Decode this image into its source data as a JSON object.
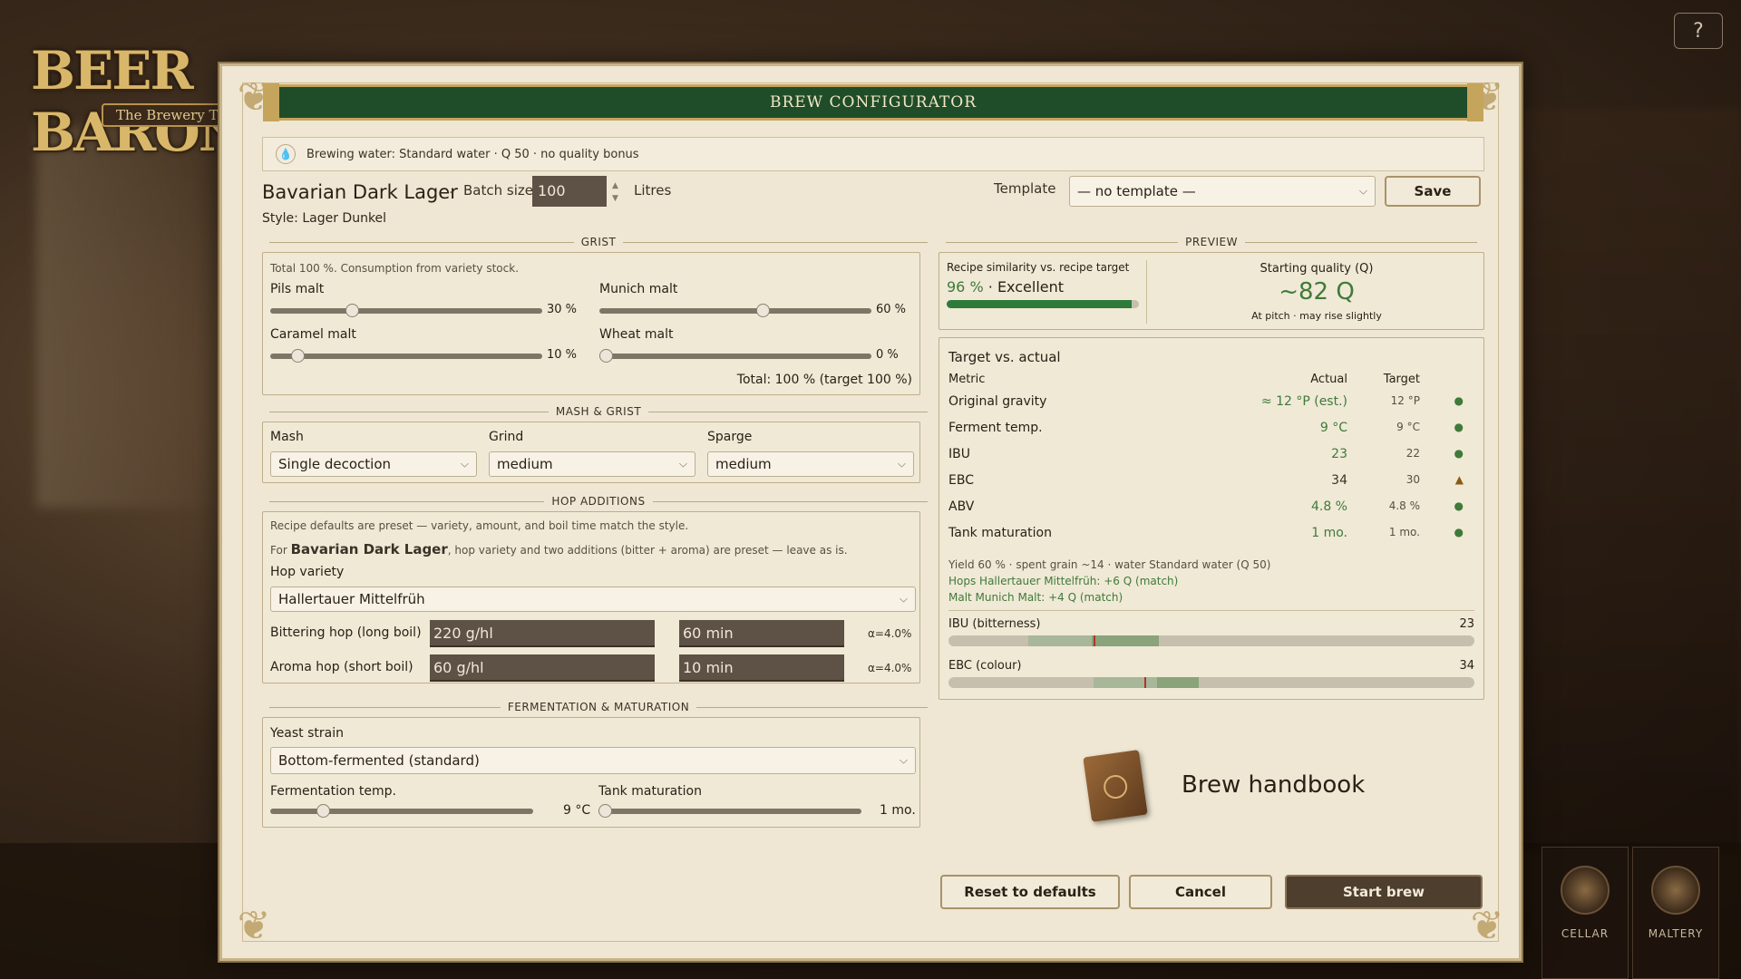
{
  "logo": {
    "main": "BEER BARON",
    "sub": "The Brewery Tycoon"
  },
  "help_label": "?",
  "nav": [
    {
      "label": "CELLAR",
      "icon": "cellar-icon"
    },
    {
      "label": "MALTERY",
      "icon": "maltery-icon"
    }
  ],
  "dialog": {
    "title": "BREW CONFIGURATOR",
    "water": "Brewing water: Standard water · Q 50 · no quality bonus",
    "recipe_name": "Bavarian Dark Lager",
    "separator": "·",
    "batch_label": "Batch size",
    "batch_value": "100",
    "batch_unit": "Litres",
    "style": "Style: Lager Dunkel",
    "template_label": "Template",
    "template_value": "— no template —",
    "save_label": "Save",
    "grist": {
      "heading": "GRIST",
      "note": "Total 100 %. Consumption from variety stock.",
      "items": [
        {
          "label": "Pils malt",
          "value": "30 %",
          "fraction": 0.3
        },
        {
          "label": "Munich malt",
          "value": "60 %",
          "fraction": 0.6
        },
        {
          "label": "Caramel malt",
          "value": "10 %",
          "fraction": 0.1
        },
        {
          "label": "Wheat malt",
          "value": "0 %",
          "fraction": 0.0
        }
      ],
      "total": "Total: 100 % (target 100 %)"
    },
    "mash": {
      "heading": "MASH & GRIST",
      "mash_label": "Mash",
      "mash_value": "Single decoction",
      "grind_label": "Grind",
      "grind_value": "medium",
      "sparge_label": "Sparge",
      "sparge_value": "medium"
    },
    "hops": {
      "heading": "HOP ADDITIONS",
      "note1": "Recipe defaults are preset — variety, amount, and boil time match the style.",
      "note2_prefix": "For",
      "note2_name": "Bavarian Dark Lager",
      "note2_suffix": ", hop variety and two additions (bitter + aroma) are preset — leave as is.",
      "variety_label": "Hop variety",
      "variety_value": "Hallertauer Mittelfrüh",
      "bitter_label": "Bittering hop (long boil)",
      "bitter_amount": "220 g/hl",
      "bitter_time": "60 min",
      "bitter_alpha": "α=4.0%",
      "aroma_label": "Aroma hop (short boil)",
      "aroma_amount": "60 g/hl",
      "aroma_time": "10 min",
      "aroma_alpha": "α=4.0%"
    },
    "fermentation": {
      "heading": "FERMENTATION & MATURATION",
      "yeast_label": "Yeast strain",
      "yeast_value": "Bottom-fermented (standard)",
      "temp_label": "Fermentation temp.",
      "temp_value": "9 °C",
      "temp_fraction": 0.2,
      "tank_label": "Tank maturation",
      "tank_value": "1 mo.",
      "tank_fraction": 0.0
    },
    "preview": {
      "heading": "PREVIEW",
      "similarity_label": "Recipe similarity vs. recipe target",
      "similarity_value": "96 %",
      "similarity_sep": "·",
      "similarity_word": "Excellent",
      "similarity_fraction": 0.96,
      "quality_label": "Starting quality (Q)",
      "quality_value": "~82 Q",
      "quality_note": "At pitch · may rise slightly",
      "target_title": "Target vs. actual",
      "col_metric": "Metric",
      "col_actual": "Actual",
      "col_target": "Target",
      "metrics": [
        {
          "name": "Original gravity",
          "actual": "≈ 12 °P (est.)",
          "target": "12 °P",
          "status": "●"
        },
        {
          "name": "Ferment temp.",
          "actual": "9 °C",
          "target": "9 °C",
          "status": "●"
        },
        {
          "name": "IBU",
          "actual": "23",
          "target": "22",
          "status": "●"
        },
        {
          "name": "EBC",
          "actual": "34",
          "target": "30",
          "status": "▲"
        },
        {
          "name": "ABV",
          "actual": "4.8 %",
          "target": "4.8 %",
          "status": "●"
        },
        {
          "name": "Tank maturation",
          "actual": "1 mo.",
          "target": "1 mo.",
          "status": "●"
        }
      ],
      "yield_note": "Yield 60 % · spent grain ~14 · water Standard water (Q 50)",
      "hops_match": "Hops Hallertauer Mittelfrüh: +6 Q (match)",
      "malt_match": "Malt Munich Malt: +4 Q (match)",
      "ibu_label": "IBU (bitterness)",
      "ibu_value": "23",
      "ebc_label": "EBC (colour)",
      "ebc_value": "34"
    },
    "handbook_label": "Brew handbook",
    "reset_label": "Reset to defaults",
    "cancel_label": "Cancel",
    "start_label": "Start brew"
  },
  "colors": {
    "title_bar": "#1f4d2a",
    "good": "#3f7a3a",
    "warn": "#8a5a10",
    "marker": "#b3332a"
  }
}
